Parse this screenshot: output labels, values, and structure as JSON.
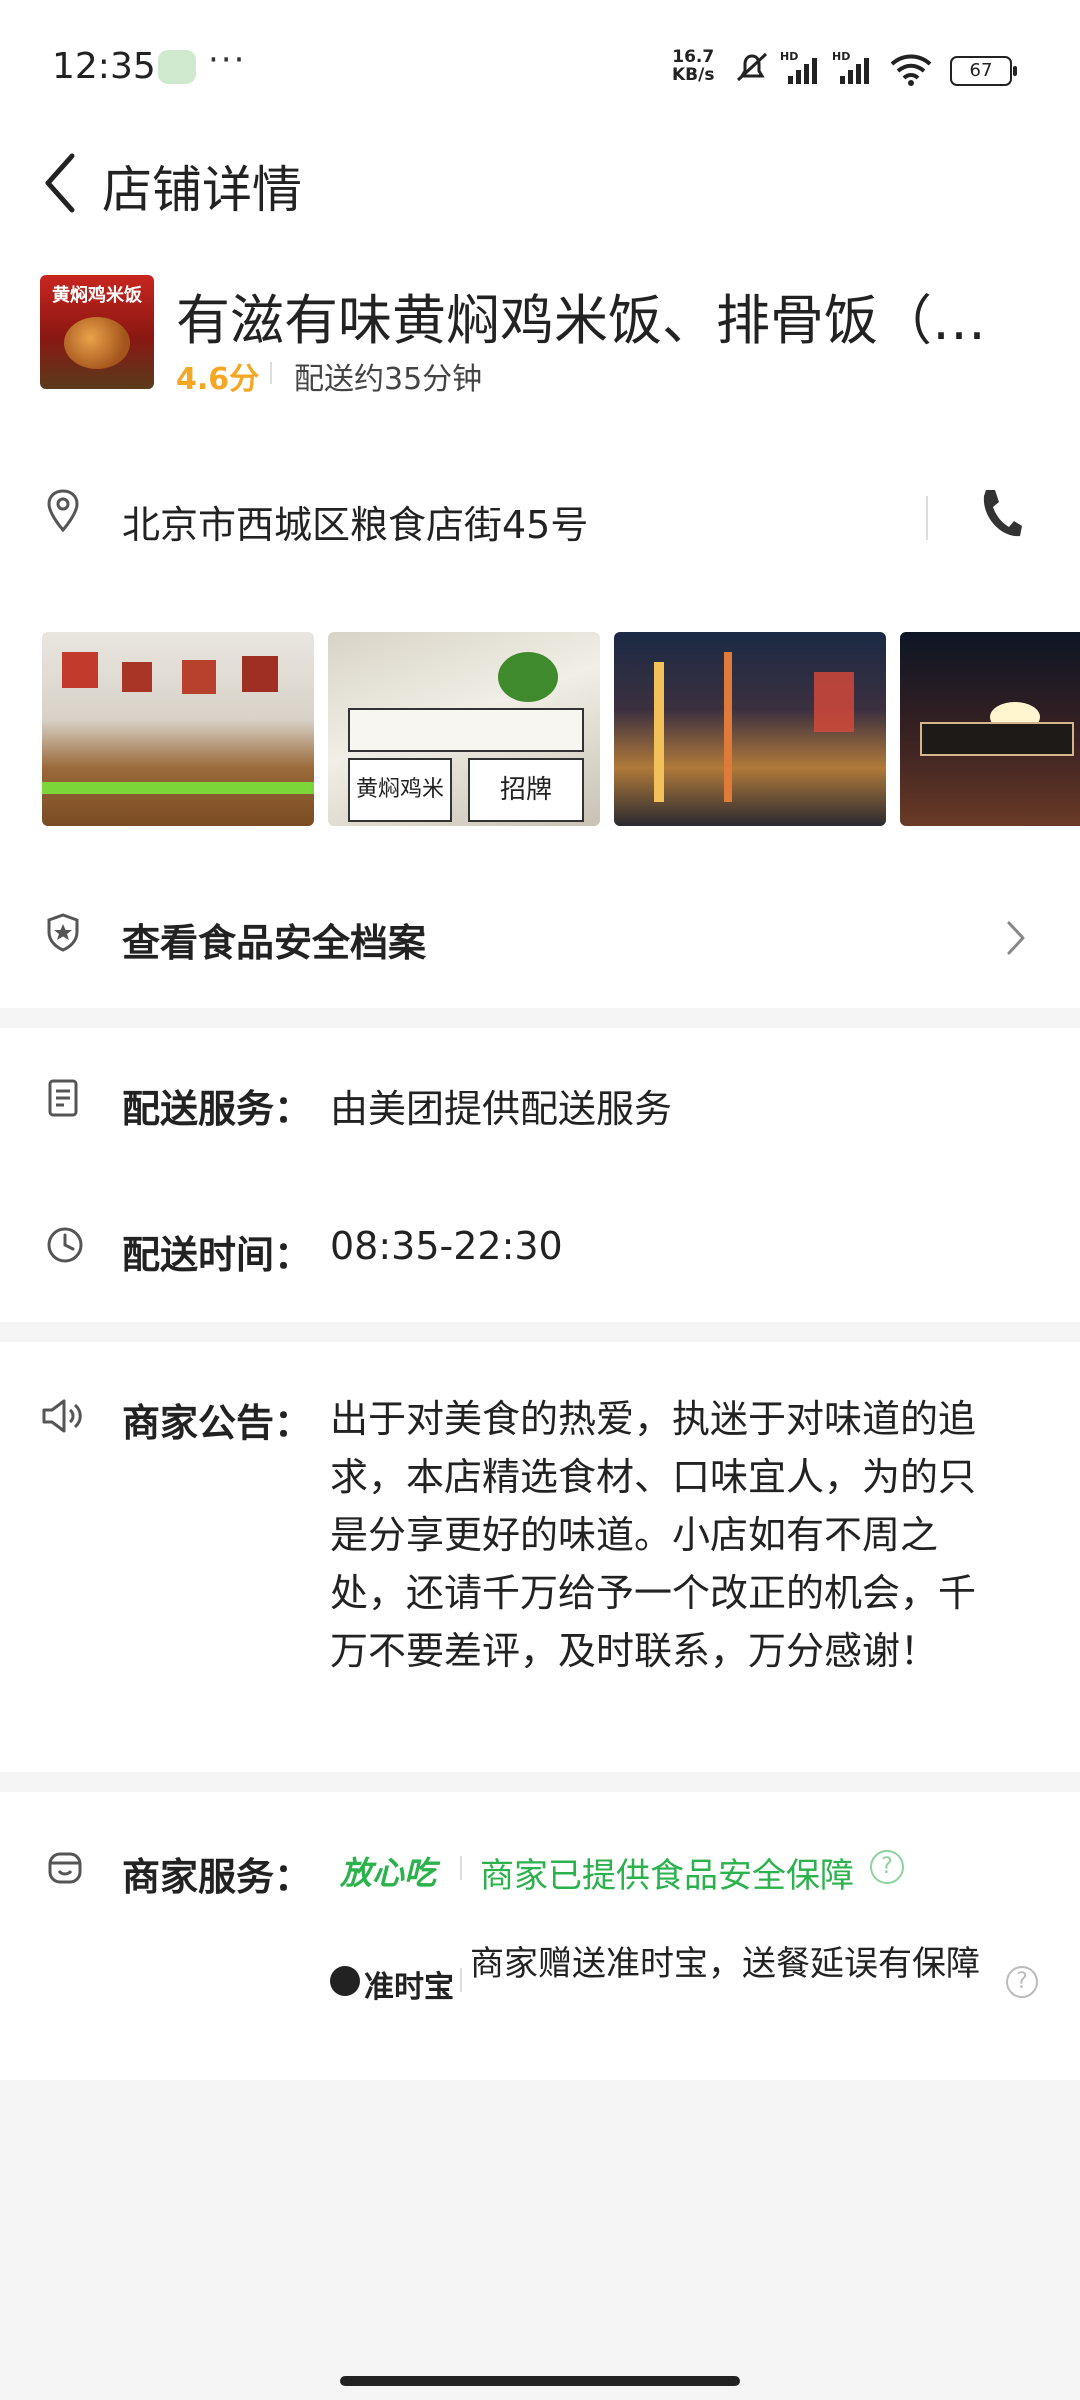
{
  "status_bar": {
    "time": "12:35",
    "menu_dots": "···",
    "speed_value": "16.7",
    "speed_unit": "KB/s",
    "battery": "67",
    "icons": [
      "wechat-icon",
      "mute-icon",
      "signal-hd-icon",
      "signal-hd-icon",
      "wifi-icon",
      "battery-icon"
    ]
  },
  "header": {
    "title": "店铺详情",
    "back_icon": "chevron-left-icon"
  },
  "store": {
    "logo_text": "黄焖鸡米饭",
    "name": "有滋有味黄焖鸡米饭、排骨饭（…",
    "rating": "4.6分",
    "delivery_estimate": "配送约35分钟"
  },
  "address": {
    "text": "北京市西城区粮食店街45号",
    "pin_icon": "location-pin-icon",
    "phone_icon": "phone-icon"
  },
  "photos": {
    "sign_text_1": "招牌",
    "sign_text_2": "黄焖鸡米饭"
  },
  "food_safety": {
    "label": "查看食品安全档案",
    "icon": "shield-star-icon"
  },
  "delivery_service": {
    "label": "配送服务：",
    "value": "由美团提供配送服务",
    "icon": "document-icon"
  },
  "delivery_time": {
    "label": "配送时间：",
    "value": "08:35-22:30",
    "icon": "clock-icon"
  },
  "notice": {
    "label": "商家公告：",
    "text": "出于对美食的热爱，执迷于对味道的追求，本店精选食材、口味宜人，为的只是分享更好的味道。小店如有不周之处，还请千万给予一个改正的机会，千万不要差评，及时联系，万分感谢！",
    "icon": "speaker-icon"
  },
  "merchant_service": {
    "label": "商家服务：",
    "icon": "service-icon",
    "fangxin_badge": "放心吃",
    "fangxin_text": "商家已提供食品安全保障",
    "zhunshi_badge": "准时宝",
    "zhunshi_text": "商家赠送准时宝，送餐延误有保障",
    "help_icon": "?"
  },
  "colors": {
    "rating": "#f5a623",
    "green": "#2bb24c",
    "text": "#222222",
    "divider": "#f5f5f5"
  }
}
